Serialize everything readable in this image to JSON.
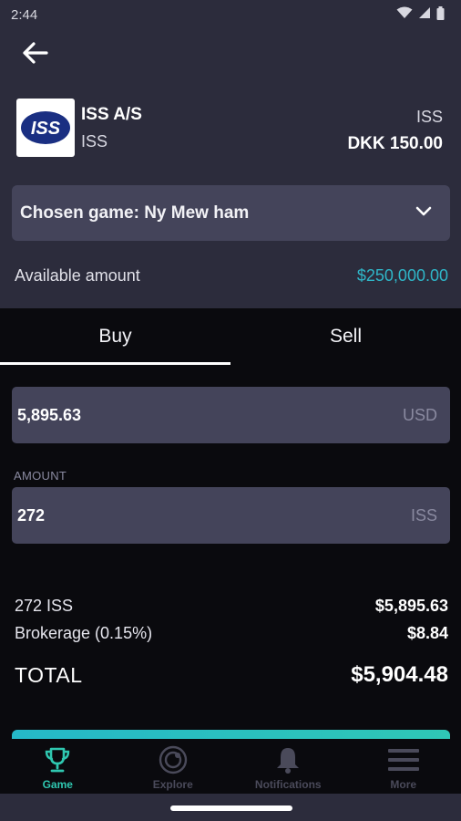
{
  "status_bar": {
    "time": "2:44"
  },
  "stock": {
    "name": "ISS A/S",
    "ticker": "ISS",
    "ticker_right": "ISS",
    "price": "DKK 150.00",
    "logo_text": "ISS"
  },
  "game_select": {
    "label": "Chosen game: Ny Mew ham"
  },
  "available": {
    "label": "Available amount",
    "value": "$250,000.00"
  },
  "tabs": [
    {
      "label": "Buy",
      "active": true
    },
    {
      "label": "Sell",
      "active": false
    }
  ],
  "price_field": {
    "value": "5,895.63",
    "unit": "USD"
  },
  "amount_field": {
    "caption": "AMOUNT",
    "value": "272",
    "unit": "ISS"
  },
  "summary": {
    "shares_label": "272 ISS",
    "shares_value": "$5,895.63",
    "brokerage_label": "Brokerage (0.15%)",
    "brokerage_value": "$8.84",
    "total_label": "TOTAL",
    "total_value": "$5,904.48"
  },
  "bottom_nav": [
    {
      "label": "Game",
      "icon": "trophy-icon",
      "active": true
    },
    {
      "label": "Explore",
      "icon": "explore-icon",
      "active": false
    },
    {
      "label": "Notifications",
      "icon": "bell-icon",
      "active": false
    },
    {
      "label": "More",
      "icon": "menu-icon",
      "active": false
    }
  ],
  "colors": {
    "background": "#2c2c3c",
    "panel": "#0a0a0e",
    "field": "#44445a",
    "accent": "#2fc7b0",
    "available_value": "#2fb6c8"
  }
}
